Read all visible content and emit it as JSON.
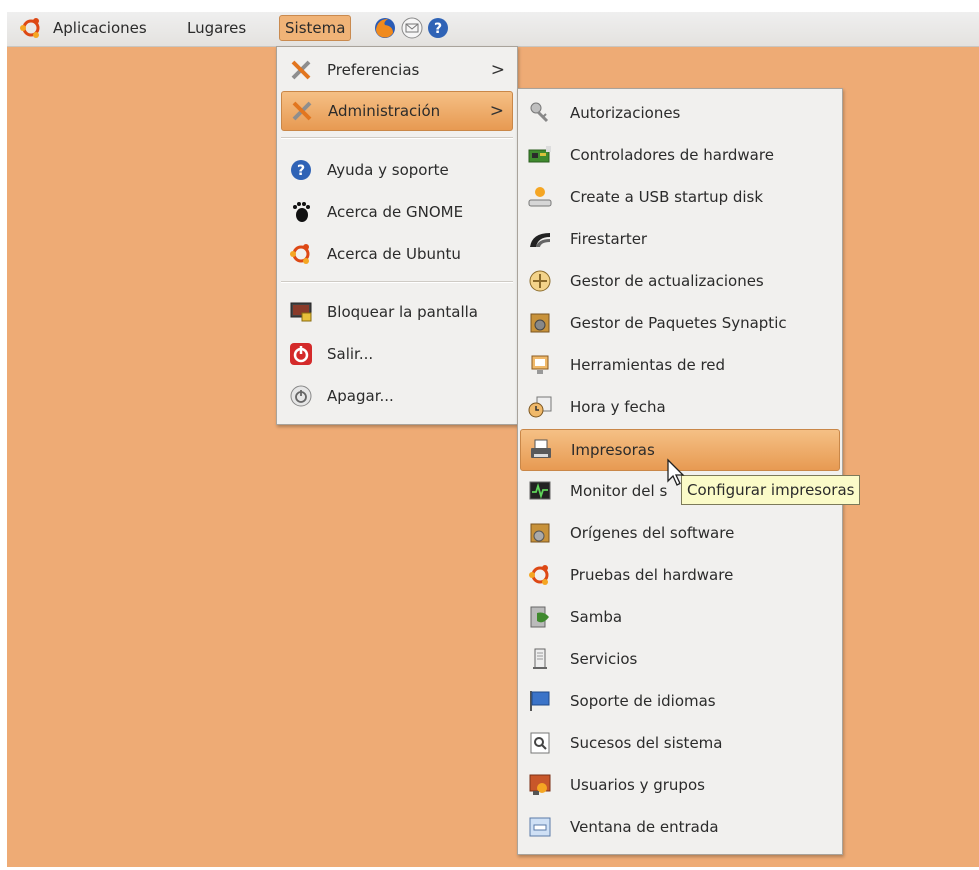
{
  "panel": {
    "menus": [
      "Aplicaciones",
      "Lugares",
      "Sistema"
    ],
    "launchers": [
      "firefox-icon",
      "mail-icon",
      "help-icon"
    ]
  },
  "system_menu": {
    "items": [
      {
        "label": "Preferencias",
        "icon": "preferences-icon",
        "submenu": true
      },
      {
        "label": "Administración",
        "icon": "administration-icon",
        "submenu": true,
        "highlighted": true
      },
      {
        "label": "Ayuda y soporte",
        "icon": "help-icon"
      },
      {
        "label": "Acerca de GNOME",
        "icon": "gnome-foot-icon"
      },
      {
        "label": "Acerca de Ubuntu",
        "icon": "ubuntu-logo-icon"
      },
      {
        "label": "Bloquear la pantalla",
        "icon": "lock-screen-icon"
      },
      {
        "label": "Salir...",
        "icon": "logout-icon"
      },
      {
        "label": "Apagar...",
        "icon": "shutdown-icon"
      }
    ]
  },
  "admin_menu": {
    "items": [
      {
        "label": "Autorizaciones",
        "icon": "keys-icon"
      },
      {
        "label": "Controladores de hardware",
        "icon": "hardware-card-icon"
      },
      {
        "label": "Create a USB startup disk",
        "icon": "usb-disk-icon"
      },
      {
        "label": "Firestarter",
        "icon": "firestarter-icon"
      },
      {
        "label": "Gestor de actualizaciones",
        "icon": "update-manager-icon"
      },
      {
        "label": "Gestor de Paquetes Synaptic",
        "icon": "synaptic-icon"
      },
      {
        "label": "Herramientas de red",
        "icon": "network-tools-icon"
      },
      {
        "label": "Hora y fecha",
        "icon": "clock-icon"
      },
      {
        "label": "Impresoras",
        "icon": "printer-icon",
        "highlighted": true
      },
      {
        "label": "Monitor del s",
        "icon": "system-monitor-icon"
      },
      {
        "label": "Orígenes del software",
        "icon": "software-sources-icon"
      },
      {
        "label": "Pruebas del hardware",
        "icon": "ubuntu-logo-icon"
      },
      {
        "label": "Samba",
        "icon": "samba-icon"
      },
      {
        "label": "Servicios",
        "icon": "services-icon"
      },
      {
        "label": "Soporte de idiomas",
        "icon": "language-flag-icon"
      },
      {
        "label": "Sucesos del sistema",
        "icon": "log-viewer-icon"
      },
      {
        "label": "Usuarios y grupos",
        "icon": "users-groups-icon"
      },
      {
        "label": "Ventana de entrada",
        "icon": "login-window-icon"
      }
    ]
  },
  "tooltip": {
    "text": "Configurar impresoras"
  },
  "colors": {
    "desktop": "#eeab75",
    "highlight": "#e79a52",
    "menu_bg": "#f1f0ee"
  }
}
